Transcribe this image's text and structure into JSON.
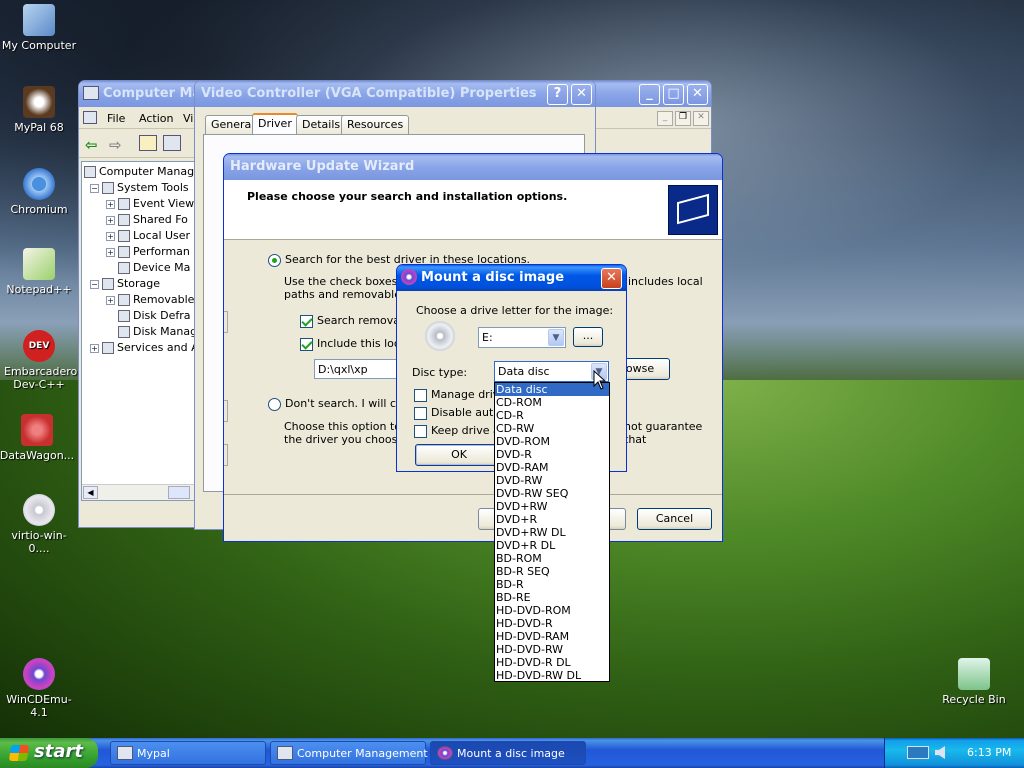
{
  "desktop": {
    "icons": [
      {
        "label": "My Computer",
        "icon": "computer-icon"
      },
      {
        "label": "MyPal 68",
        "icon": "raccoon-icon"
      },
      {
        "label": "Chromium",
        "icon": "chromium-icon"
      },
      {
        "label": "Notepad++",
        "icon": "notepad-icon"
      },
      {
        "label": "Embarcadero Dev-C++",
        "icon": "devcpp-icon"
      },
      {
        "label": "DataWagon...",
        "icon": "datawagon-icon"
      },
      {
        "label": "virtio-win-0....",
        "icon": "disc-icon"
      },
      {
        "label": "WinCDEmu-4.1",
        "icon": "wincdemu-icon"
      },
      {
        "label": "Recycle Bin",
        "icon": "recycle-bin-icon"
      }
    ]
  },
  "comp_mgmt": {
    "title": "Computer Manag",
    "menu": [
      "File",
      "Action",
      "Vi"
    ],
    "tree": [
      {
        "label": "Computer Manage",
        "indent": 0
      },
      {
        "label": "System Tools",
        "indent": 1
      },
      {
        "label": "Event View",
        "indent": 2
      },
      {
        "label": "Shared Fo",
        "indent": 2
      },
      {
        "label": "Local User",
        "indent": 2
      },
      {
        "label": "Performan",
        "indent": 2
      },
      {
        "label": "Device Ma",
        "indent": 2
      },
      {
        "label": "Storage",
        "indent": 1
      },
      {
        "label": "Removable",
        "indent": 2
      },
      {
        "label": "Disk Defra",
        "indent": 2
      },
      {
        "label": "Disk Manag",
        "indent": 2
      },
      {
        "label": "Services and A",
        "indent": 1
      }
    ]
  },
  "props": {
    "title": "Video Controller (VGA Compatible) Properties",
    "tabs": [
      "General",
      "Driver",
      "Details",
      "Resources"
    ]
  },
  "wizard": {
    "title": "Hardware Update Wizard",
    "heading": "Please choose your search and installation options.",
    "opt_search": "Search for the best driver in these locations.",
    "search_desc1": "Use the check boxes b",
    "search_desc1_tail": "includes local",
    "search_desc2": "paths and removable me",
    "cb_removable": "Search removable",
    "cb_include": "Include this locati",
    "location_value": "D:\\qxl\\xp",
    "browse_label": "owse",
    "opt_dont": "Don't search. I will choo",
    "dont_desc1": "Choose this option to se",
    "dont_desc1_tail": "not guarantee that",
    "dont_desc2": "the driver you choose w",
    "cancel_label": "Cancel"
  },
  "mount": {
    "title": "Mount a disc image",
    "drive_prompt": "Choose a drive letter for the image:",
    "drive_value": "E:",
    "browse_dots": "...",
    "disc_type_label": "Disc type:",
    "disc_type_value": "Data disc",
    "cb_manage": "Manage drive",
    "cb_disable": "Disable autoru",
    "cb_keep": "Keep drive af",
    "ok_label": "OK",
    "options": [
      "Data disc",
      "CD-ROM",
      "CD-R",
      "CD-RW",
      "DVD-ROM",
      "DVD-R",
      "DVD-RAM",
      "DVD-RW",
      "DVD-RW SEQ",
      "DVD+RW",
      "DVD+R",
      "DVD+RW DL",
      "DVD+R DL",
      "BD-ROM",
      "BD-R SEQ",
      "BD-R",
      "BD-RE",
      "HD-DVD-ROM",
      "HD-DVD-R",
      "HD-DVD-RAM",
      "HD-DVD-RW",
      "HD-DVD-R DL",
      "HD-DVD-RW DL"
    ]
  },
  "taskbar": {
    "start_label": "start",
    "items": [
      "Mypal",
      "Computer Management",
      "Mount a disc image"
    ],
    "clock": "6:13 PM"
  }
}
